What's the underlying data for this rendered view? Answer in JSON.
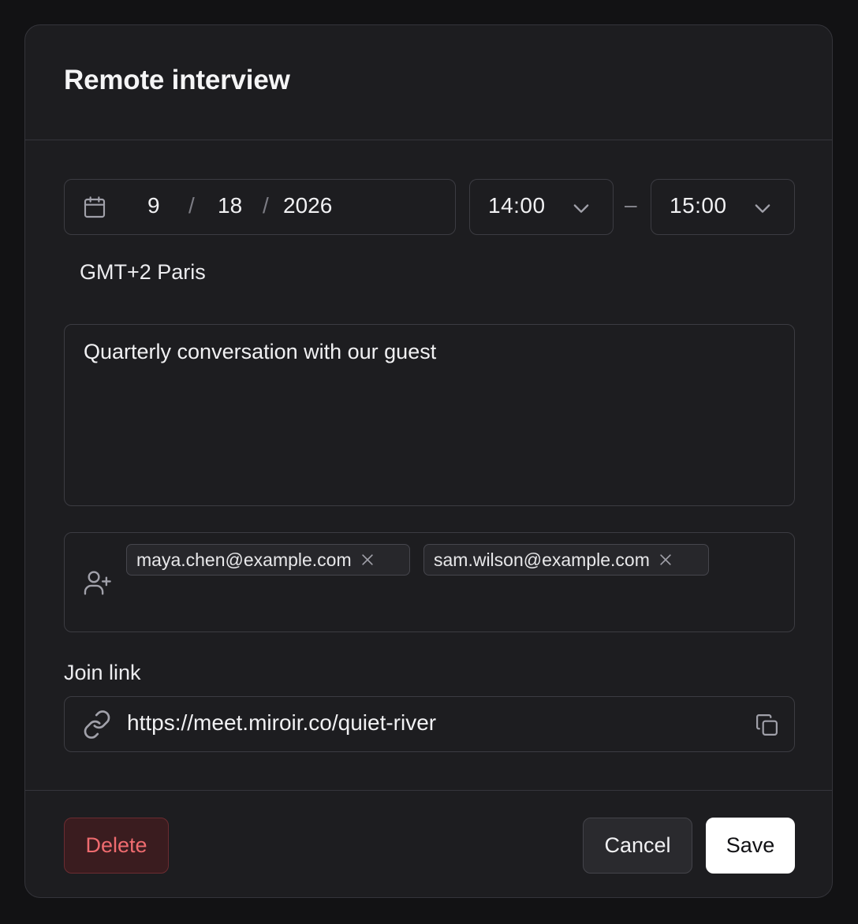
{
  "dialog": {
    "title": "Remote interview"
  },
  "date": {
    "month": "9",
    "day": "18",
    "year": "2026",
    "separator": "/",
    "icon": "calendar-icon"
  },
  "time": {
    "start": "14:00",
    "end": "15:00",
    "dash": "–",
    "icon": "chevron-down-icon"
  },
  "timezone": "GMT+2 Paris",
  "description": {
    "value": "Quarterly conversation with our guest"
  },
  "guests": {
    "icon": "add-user-icon",
    "chips": [
      {
        "email": "maya.chen@example.com"
      },
      {
        "email": "sam.wilson@example.com"
      }
    ]
  },
  "join_link": {
    "label": "Join link",
    "url": "https://meet.miroir.co/quiet-river",
    "icon": "link-icon",
    "copy_icon": "copy-icon"
  },
  "footer": {
    "delete_label": "Delete",
    "cancel_label": "Cancel",
    "save_label": "Save"
  },
  "colors": {
    "background": "#121214",
    "surface": "#1d1d20",
    "border": "#3c3c42",
    "danger": "#ef6b6f",
    "primary_button": "#ffffff"
  }
}
